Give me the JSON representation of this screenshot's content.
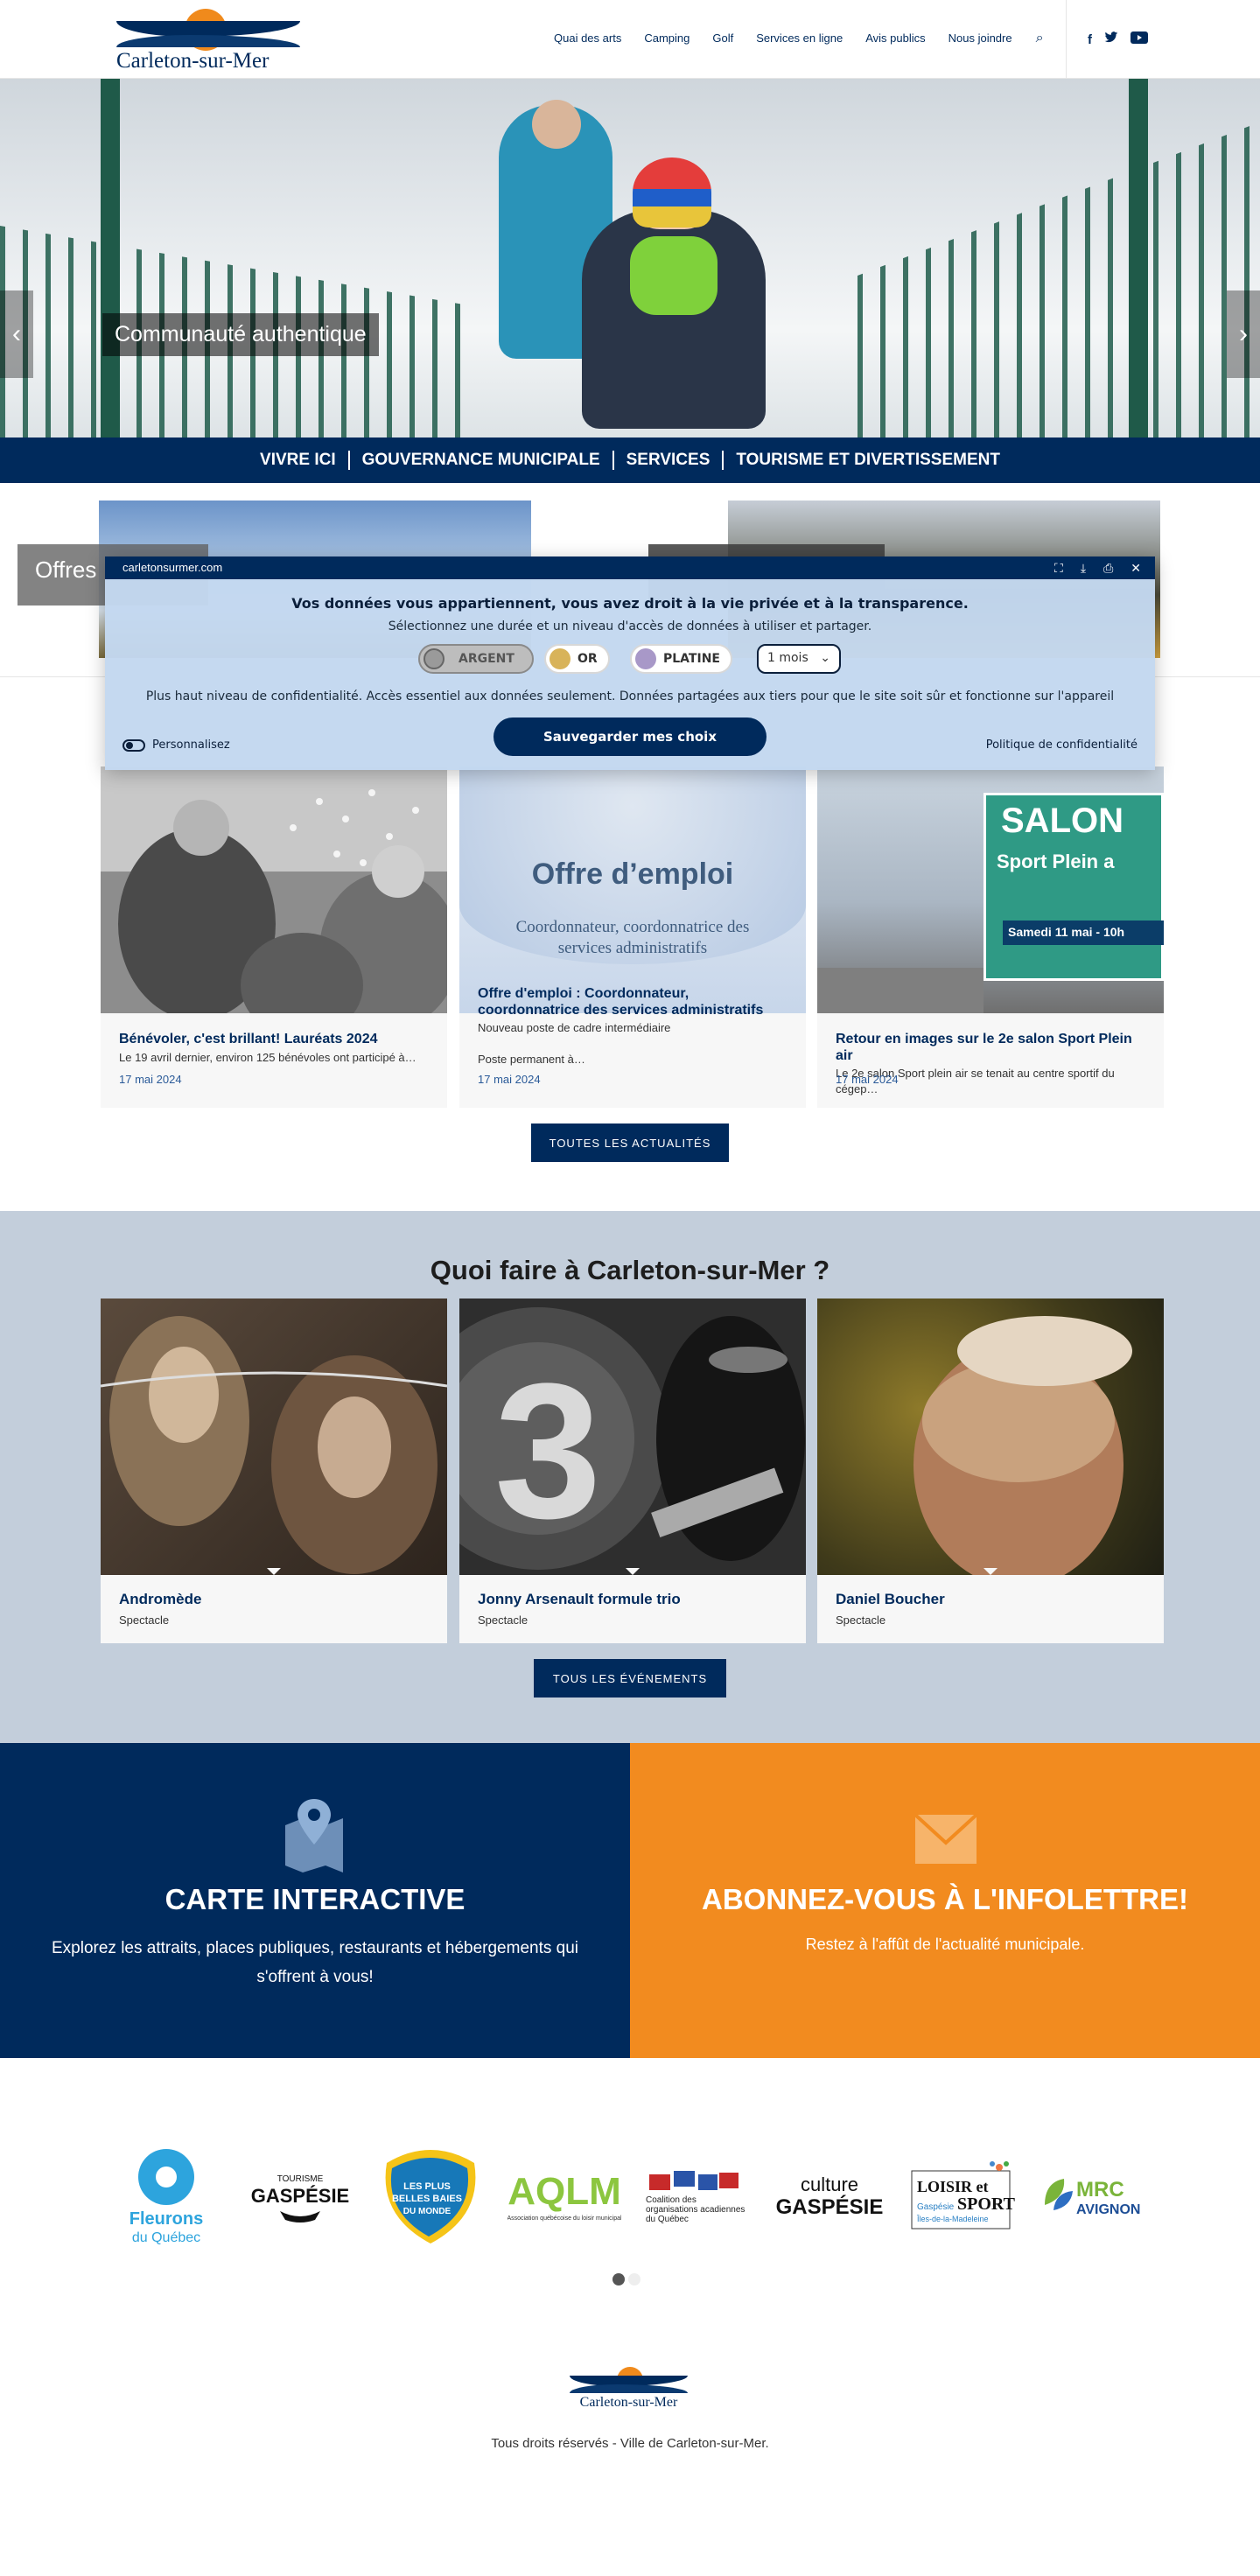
{
  "header": {
    "logo_text": "Carleton-sur-Mer",
    "nav": [
      "Quai des arts",
      "Camping",
      "Golf",
      "Services en ligne",
      "Avis publics",
      "Nous joindre"
    ],
    "search_icon": "⌕",
    "social": {
      "facebook": "f",
      "twitter": "🐦",
      "youtube": "▶"
    }
  },
  "hero": {
    "caption": "Communauté authentique",
    "prev": "‹",
    "next": "›",
    "slides": 3,
    "active_slide": 1
  },
  "mainmenu": [
    "VIVRE ICI",
    "GOUVERNANCE MUNICIPALE",
    "SERVICES",
    "TOURISME ET DIVERTISSEMENT"
  ],
  "offres": {
    "label": "Offres"
  },
  "consent": {
    "domain": "carletonsurmer.com",
    "heading": "Vos données vous appartiennent, vous avez droit à la vie privée et à la transparence.",
    "sub": "Sélectionnez une durée et un niveau d'accès de données à utiliser et partager.",
    "tiers": [
      {
        "label": "ARGENT",
        "color": "#9a9a9a"
      },
      {
        "label": "OR",
        "color": "#d8b35a"
      },
      {
        "label": "PLATINE",
        "color": "#a898c8"
      }
    ],
    "duration": "1 mois",
    "description": "Plus haut niveau de confidentialité. Accès essentiel aux données seulement. Données partagées aux tiers pour que le site soit sûr et fonctionne sur l'appareil",
    "save": "Sauvegarder mes choix",
    "customize": "Personnalisez",
    "policy": "Politique de confidentialité"
  },
  "news": [
    {
      "title": "Bénévoler, c'est brillant! Lauréats 2024",
      "excerpt": "Le 19 avril dernier, environ 125 bénévoles ont participé à…",
      "date": "17 mai 2024"
    },
    {
      "title": "Offre d'emploi : Coordonnateur, coordonnatrice des services administratifs",
      "excerpt": "Nouveau poste de cadre intermédiaire",
      "excerpt2": "Poste permanent à…",
      "date": "17 mai 2024",
      "img_title": "Offre d’emploi",
      "img_sub": "Coordonnateur, coordonnatrice des services administratifs"
    },
    {
      "title": "Retour en images sur le 2e salon Sport Plein air",
      "excerpt": "Le 2e salon Sport plein air se tenait au centre sportif du cégep…",
      "date": "17 mai 2024",
      "img_sign": "SALON",
      "img_sign2": "Sport Plein a",
      "img_sign3": "Samedi 11 mai - 10h"
    }
  ],
  "news_button": "TOUTES LES ACTUALITÉS",
  "events": {
    "heading": "Quoi faire à Carleton-sur-Mer ?",
    "items": [
      {
        "title": "Andromède",
        "type": "Spectacle"
      },
      {
        "title": "Jonny Arsenault formule trio",
        "type": "Spectacle"
      },
      {
        "title": "Daniel Boucher",
        "type": "Spectacle"
      }
    ],
    "button": "TOUS LES ÉVÉNEMENTS"
  },
  "cta": {
    "map_title": "CARTE INTERACTIVE",
    "map_text": "Explorez les attraits, places publiques, restaurants et hébergements qui s'offrent à vous!",
    "news_title": "ABONNEZ-VOUS À L'INFOLETTRE!",
    "news_text": "Restez à l'affût de l'actualité municipale."
  },
  "partners": [
    {
      "name": "Les Fleurons du Québec"
    },
    {
      "name": "TOURISME GASPÉSIE"
    },
    {
      "name": "LES PLUS BELLES BAIES DU MONDE"
    },
    {
      "name": "AQLM"
    },
    {
      "name": "Coalition des organisations acadiennes du Québec"
    },
    {
      "name": "culture GASPÉSIE"
    },
    {
      "name": "LOISIR ET SPORT Gaspésie Îles-de-la-Madeleine"
    },
    {
      "name": "MRC AVIGNON"
    }
  ],
  "footer": {
    "logo_text": "Carleton-sur-Mer",
    "copyright": "Tous droits réservés - Ville de Carleton-sur-Mer."
  },
  "colors": {
    "navy": "#002a5c",
    "orange": "#f28b1f",
    "events_bg": "#c3cedb"
  }
}
